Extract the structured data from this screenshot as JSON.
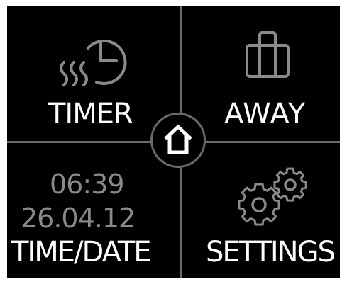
{
  "tiles": {
    "timer": {
      "label": "TIMER",
      "icon": "timer-heat-icon"
    },
    "away": {
      "label": "AWAY",
      "icon": "suitcase-icon"
    },
    "time_date": {
      "label": "TIME/DATE",
      "time": "06:39",
      "date": "26.04.12"
    },
    "settings": {
      "label": "SETTINGS",
      "icon": "gears-icon"
    }
  },
  "home": {
    "icon": "home-icon"
  },
  "colors": {
    "background": "#000000",
    "divider": "#6b6b6b",
    "icon_stroke": "#8a8a8a",
    "label": "#ffffff",
    "readout": "#8a8a8a"
  }
}
